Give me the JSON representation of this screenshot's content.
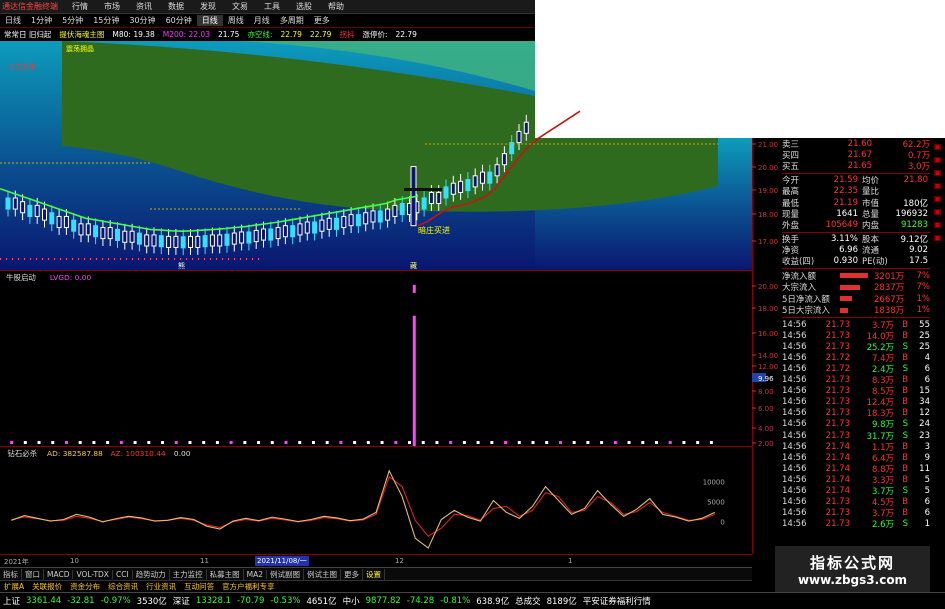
{
  "titlebar": {
    "app": "通达信金融终端",
    "menu": [
      "行情",
      "市场",
      "资讯",
      "数据",
      "发现",
      "文易",
      "工具",
      "选股",
      "帮助"
    ]
  },
  "toolbar": [
    "日线",
    "1分钟",
    "5分钟",
    "15分钟",
    "30分钟",
    "60分钟",
    "日线",
    "周线",
    "月线",
    "多周期",
    "更多"
  ],
  "legend": {
    "prefix": "常常日 旧归起",
    "title": "提伏海魂主图",
    "m80": "M80: 19.38",
    "m200": "M200: 22.03",
    "v1": "21.75",
    "v2_label": "亦空线:",
    "v2": "22.79",
    "v3": "22.79",
    "tag": "拐抖",
    "price_label": "涨停价:",
    "price": "22.79",
    "note1": "震荡拥晶",
    "note2": "主力资本"
  },
  "chart_data": [
    {
      "type": "candlestick",
      "title": "",
      "y_ticks": [
        17.0,
        18.0,
        19.0,
        20.0,
        21.0
      ],
      "ylim": [
        16.4,
        22.6
      ],
      "ma_green": [
        18.6,
        18.5,
        18.4,
        18.3,
        18.2,
        18.1,
        18.0,
        17.9,
        17.8,
        17.75,
        17.7,
        17.65,
        17.6,
        17.55,
        17.5,
        17.48,
        17.46,
        17.45,
        17.46,
        17.48,
        17.5,
        17.52,
        17.55,
        17.58,
        17.62,
        17.66,
        17.7,
        17.75,
        17.8,
        17.85,
        17.9,
        17.95,
        18.0,
        18.05,
        18.1,
        18.15,
        18.2,
        18.3,
        18.35,
        18.4
      ],
      "ma_red": [
        17.6,
        17.7,
        17.85,
        18.0,
        18.1,
        18.15,
        18.2,
        18.3,
        18.4,
        18.6,
        18.9,
        19.2,
        19.5,
        19.75,
        19.95,
        20.1,
        20.25,
        20.4,
        20.55,
        20.7
      ],
      "annotation_buy": "暗庄买进",
      "xlabel_tag": "藏",
      "xlabel_tag2": "熊"
    },
    {
      "type": "bar",
      "title": "牛股启动",
      "series_label": "LVGD: 0.00",
      "y_ticks": [
        20.0,
        18.0,
        16.0,
        14.0,
        12.0,
        9.96,
        8.0,
        6.0,
        4.0,
        2.0
      ],
      "spike_value": 20.0
    },
    {
      "type": "line",
      "title": "钻石必杀",
      "series_label": "AD: 382587.88",
      "series_label2": "AZ: 100310.44",
      "series_label3": "0.00",
      "y_ticks": [
        10000,
        5000,
        0
      ],
      "series": [
        {
          "name": "AD",
          "values": [
            1000,
            2200,
            1500,
            800,
            1200,
            2500,
            1800,
            600,
            1400,
            2000,
            1600,
            800,
            1000,
            1700,
            1200,
            -500,
            -1200,
            800,
            1500,
            900,
            1800,
            1300,
            700,
            1200,
            2000,
            1600,
            900,
            1300,
            3000,
            13500,
            7000,
            -3500,
            -6000,
            1200,
            3500,
            1800,
            800,
            6000,
            3000,
            1500,
            4500,
            9500,
            6000,
            2500,
            4000,
            8500,
            5000,
            2000,
            3800,
            6500,
            2500,
            1800,
            800,
            1500,
            3000
          ]
        },
        {
          "name": "AZ",
          "values": [
            1200,
            1800,
            1400,
            900,
            1000,
            2000,
            1500,
            700,
            1200,
            1800,
            1400,
            900,
            1000,
            1500,
            1000,
            -200,
            -800,
            600,
            1200,
            800,
            1500,
            1100,
            600,
            1000,
            1700,
            1400,
            800,
            1100,
            2500,
            12000,
            9500,
            1000,
            -3000,
            -1000,
            2500,
            2200,
            1000,
            4000,
            4500,
            2000,
            3500,
            8000,
            7000,
            3000,
            3500,
            7000,
            5500,
            2500,
            3200,
            5500,
            3000,
            2000,
            1000,
            1200,
            2500
          ]
        }
      ]
    }
  ],
  "xaxis": [
    "2021年",
    "10",
    "11",
    "2021/11/08/一",
    "12",
    "1"
  ],
  "bottomtabs": [
    "指标",
    "窗口",
    "MACD",
    "VOL-TDX",
    "CCI",
    "趋势动力",
    "主力监控",
    "私募主图",
    "MA2",
    "例试副图",
    "例试主图",
    "更多",
    "设置"
  ],
  "fbtabs": [
    "扩展A",
    "关联报价",
    "资金分布",
    "综合资讯",
    "行业资讯",
    "互动问答",
    "官方户福利专享"
  ],
  "status": {
    "sh_label": "上证",
    "sh_val": "3361.44",
    "sh_chg": "-32.81",
    "sh_pct": "-0.97%",
    "sh_amt": "3530亿",
    "sz_label": "深证",
    "sz_val": "13328.1",
    "sz_chg": "-70.79",
    "sz_pct": "-0.53%",
    "sz_amt": "4651亿",
    "zx_label": "中小",
    "zx_val": "9877.82",
    "zx_chg": "-74.28",
    "zx_pct": "-0.81%",
    "zx_amt": "638.9亿",
    "tot_label": "总成交",
    "tot_amt": "8189亿",
    "broker": "平安证券福利行情"
  },
  "quote": {
    "top": [
      {
        "k": "卖三",
        "v": "21.60",
        "n": "62.2万",
        "c": "red"
      },
      {
        "k": "买四",
        "v": "21.67",
        "n": "0.7万",
        "c": "red"
      },
      {
        "k": "买五",
        "v": "21.65",
        "n": "3.0万",
        "c": "red"
      }
    ],
    "mid": [
      {
        "k": "今开",
        "v": "21.59",
        "k2": "均价",
        "v2": "21.80",
        "c": "red",
        "c2": "red"
      },
      {
        "k": "最高",
        "v": "22.35",
        "k2": "量比",
        "v2": "",
        "c": "red",
        "c2": "white"
      },
      {
        "k": "最低",
        "v": "21.19",
        "k2": "市值",
        "v2": "180亿",
        "c": "red",
        "c2": "white"
      },
      {
        "k": "现量",
        "v": "1641",
        "k2": "总量",
        "v2": "196932",
        "c": "white",
        "c2": "white"
      },
      {
        "k": "外盘",
        "v": "105649",
        "k2": "内盘",
        "v2": "91283",
        "c": "red",
        "c2": "green"
      }
    ],
    "mid2": [
      {
        "k": "换手",
        "v": "3.11%",
        "k2": "股本",
        "v2": "9.12亿",
        "c": "white",
        "c2": "white"
      },
      {
        "k": "净资",
        "v": "6.96",
        "k2": "流通",
        "v2": "9.02",
        "c": "white",
        "c2": "white"
      },
      {
        "k": "收益(四)",
        "v": "0.930",
        "k2": "PE(动)",
        "v2": "17.5",
        "c": "white",
        "c2": "white"
      }
    ],
    "flows": [
      {
        "k": "净流入额",
        "bar": 28,
        "v": "3201万",
        "p": "7%"
      },
      {
        "k": "大宗流入",
        "bar": 20,
        "v": "2837万",
        "p": "7%"
      },
      {
        "k": "5日净流入额",
        "bar": 12,
        "v": "2667万",
        "p": "1%"
      },
      {
        "k": "5日大宗流入",
        "bar": 8,
        "v": "1838万",
        "p": "1%"
      }
    ],
    "ticks": [
      {
        "t": "14:56",
        "p": "21.73",
        "v": "3.7万",
        "s": "B",
        "n": "55"
      },
      {
        "t": "14:56",
        "p": "21.73",
        "v": "14.0万",
        "s": "B",
        "n": "25"
      },
      {
        "t": "14:56",
        "p": "21.73",
        "v": "25.2万",
        "s": "S",
        "n": "25"
      },
      {
        "t": "14:56",
        "p": "21.72",
        "v": "7.4万",
        "s": "B",
        "n": "4"
      },
      {
        "t": "14:56",
        "p": "21.72",
        "v": "2.4万",
        "s": "S",
        "n": "6"
      },
      {
        "t": "14:56",
        "p": "21.73",
        "v": "8.3万",
        "s": "B",
        "n": "6"
      },
      {
        "t": "14:56",
        "p": "21.73",
        "v": "8.5万",
        "s": "B",
        "n": "15"
      },
      {
        "t": "14:56",
        "p": "21.73",
        "v": "12.4万",
        "s": "B",
        "n": "34"
      },
      {
        "t": "14:56",
        "p": "21.73",
        "v": "18.3万",
        "s": "B",
        "n": "12"
      },
      {
        "t": "14:56",
        "p": "21.73",
        "v": "9.8万",
        "s": "S",
        "n": "24"
      },
      {
        "t": "14:56",
        "p": "21.73",
        "v": "31.7万",
        "s": "S",
        "n": "23"
      },
      {
        "t": "14:56",
        "p": "21.74",
        "v": "1.1万",
        "s": "B",
        "n": "3"
      },
      {
        "t": "14:56",
        "p": "21.74",
        "v": "6.4万",
        "s": "B",
        "n": "9"
      },
      {
        "t": "14:56",
        "p": "21.74",
        "v": "8.8万",
        "s": "B",
        "n": "11"
      },
      {
        "t": "14:56",
        "p": "21.74",
        "v": "3.3万",
        "s": "B",
        "n": "5"
      },
      {
        "t": "14:56",
        "p": "21.74",
        "v": "3.7万",
        "s": "S",
        "n": "5"
      },
      {
        "t": "14:56",
        "p": "21.73",
        "v": "4.5万",
        "s": "B",
        "n": "6"
      },
      {
        "t": "14:56",
        "p": "21.73",
        "v": "3.7万",
        "s": "B",
        "n": "6"
      },
      {
        "t": "14:56",
        "p": "21.73",
        "v": "2.6万",
        "s": "S",
        "n": "1"
      }
    ]
  },
  "watermark": {
    "line1": "指标公式网",
    "line2": "www.zbgs3.com"
  },
  "colors": {
    "up": "#ff3333",
    "down": "#00ffff",
    "green_band": "#2e6b1e",
    "blue_band": "#0b8fb0"
  }
}
